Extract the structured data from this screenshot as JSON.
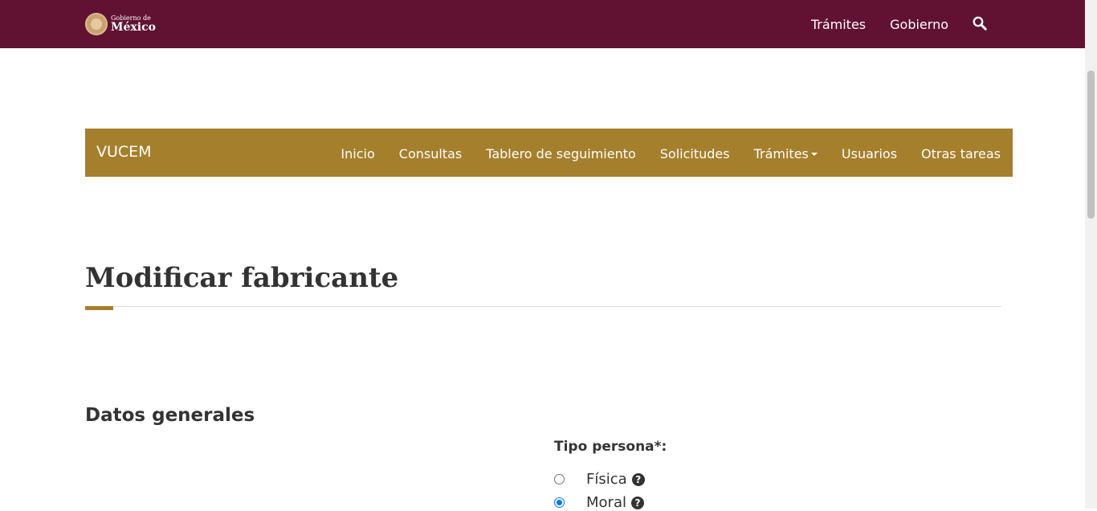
{
  "header": {
    "logo": {
      "line1": "Gobierno de",
      "line2": "México"
    },
    "nav": [
      {
        "label": "Trámites"
      },
      {
        "label": "Gobierno"
      }
    ],
    "search_icon": "search-icon"
  },
  "subnav": {
    "brand": "VUCEM",
    "menu": [
      {
        "label": "Inicio"
      },
      {
        "label": "Consultas"
      },
      {
        "label": "Tablero de seguimiento"
      },
      {
        "label": "Solicitudes"
      },
      {
        "label": "Trámites"
      },
      {
        "label": "Usuarios"
      },
      {
        "label": "Otras tareas"
      }
    ]
  },
  "page": {
    "title": "Modificar fabricante",
    "section_title": "Datos generales",
    "tipo_persona": {
      "label": "Tipo persona*:",
      "options": [
        {
          "label": "Física",
          "checked": false,
          "help_icon": "question-circle-icon"
        },
        {
          "label": "Moral",
          "checked": true,
          "help_icon": "question-circle-icon"
        }
      ]
    }
  },
  "colors": {
    "header_bg": "#611232",
    "subnav_bg": "#a57f2c",
    "accent": "#a57f2c",
    "radio_checked": "#0075ff"
  }
}
